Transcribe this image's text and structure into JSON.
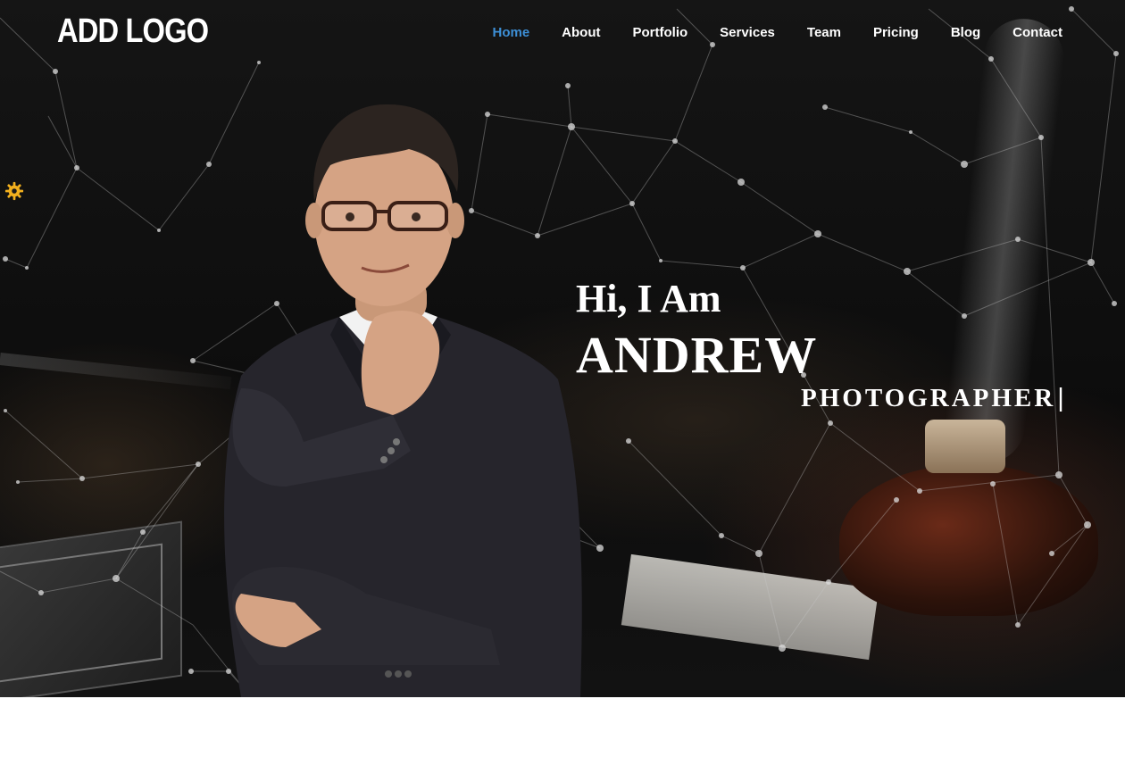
{
  "logo": {
    "text": "ADD LOGO"
  },
  "nav": {
    "items": [
      {
        "label": "Home",
        "active": true
      },
      {
        "label": "About",
        "active": false
      },
      {
        "label": "Portfolio",
        "active": false
      },
      {
        "label": "Services",
        "active": false
      },
      {
        "label": "Team",
        "active": false
      },
      {
        "label": "Pricing",
        "active": false
      },
      {
        "label": "Blog",
        "active": false
      },
      {
        "label": "Contact",
        "active": false
      }
    ]
  },
  "hero": {
    "greeting": "Hi, I Am",
    "name": "ANDREW",
    "role": "PHOTOGRAPHER",
    "cursor": "|"
  },
  "settings_icon": {
    "icon": "gear-icon",
    "color": "#f2b01e"
  },
  "colors": {
    "nav_active": "#3d8fd6",
    "nav_text": "#ffffff",
    "hero_background": "#101010"
  }
}
